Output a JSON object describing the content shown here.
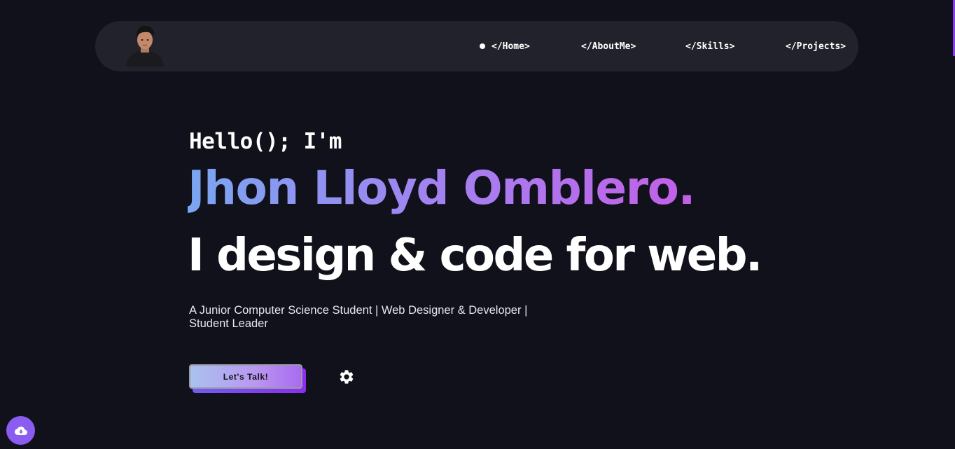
{
  "nav": {
    "avatar_alt": "profile photo",
    "items": [
      {
        "label": "</Home>",
        "active": true
      },
      {
        "label": "</AboutMe>",
        "active": false
      },
      {
        "label": "</Skills>",
        "active": false
      },
      {
        "label": "</Projects>",
        "active": false
      }
    ]
  },
  "hero": {
    "greeting": "Hello(); I'm",
    "name": "Jhon Lloyd Omblero.",
    "tagline": "I design & code for web.",
    "subtitle_line1": "A Junior Computer Science Student | Web Designer & Developer |",
    "subtitle_line2": "Student Leader",
    "cta_label": "Let's Talk!"
  },
  "icons": {
    "settings": "gear-icon",
    "download": "cloud-download-icon",
    "nav_active": "dot-icon"
  },
  "colors": {
    "background": "#11111b",
    "navbar": "#22222c",
    "name_gradient_start": "#7aa6f0",
    "name_gradient_end": "#c35fe6",
    "accent_purple": "#8a5cf0"
  }
}
